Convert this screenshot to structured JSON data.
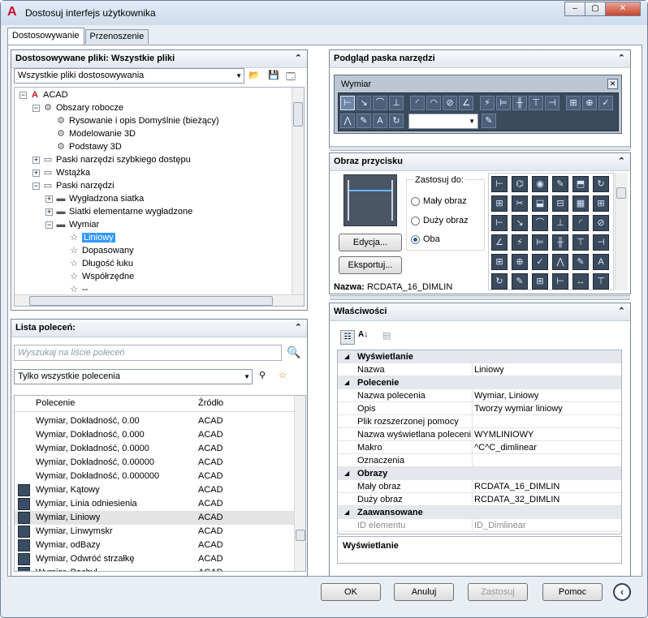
{
  "window": {
    "title": "Dostosuj interfejs użytkownika",
    "minimize": "–",
    "maximize": "▢",
    "close": "✕"
  },
  "tabs": [
    {
      "label": "Dostosowywanie"
    },
    {
      "label": "Przenoszenie"
    }
  ],
  "files_panel": {
    "title": "Dostosowywane pliki: Wszystkie pliki",
    "selector": "Wszystkie pliki dostosowywania"
  },
  "tree": [
    {
      "label": "ACAD",
      "depth": 0,
      "tog": "−",
      "icon": "A"
    },
    {
      "label": "Obszary robocze",
      "depth": 1,
      "tog": "−",
      "icon": "⚙"
    },
    {
      "label": "Rysowanie i opis Domyślnie (bieżący)",
      "depth": 2,
      "tog": "",
      "icon": "⚙"
    },
    {
      "label": "Modelowanie 3D",
      "depth": 2,
      "tog": "",
      "icon": "⚙"
    },
    {
      "label": "Podstawy 3D",
      "depth": 2,
      "tog": "",
      "icon": "⚙"
    },
    {
      "label": "Paski narzędzi szybkiego dostępu",
      "depth": 1,
      "tog": "+",
      "icon": "▭"
    },
    {
      "label": "Wstążka",
      "depth": 1,
      "tog": "+",
      "icon": "▭"
    },
    {
      "label": "Paski narzędzi",
      "depth": 1,
      "tog": "−",
      "icon": "▭"
    },
    {
      "label": "Wygładzona siatka",
      "depth": 2,
      "tog": "+",
      "icon": "▬"
    },
    {
      "label": "Siatki elementarne wygładzone",
      "depth": 2,
      "tog": "+",
      "icon": "▬"
    },
    {
      "label": "Wymiar",
      "depth": 2,
      "tog": "−",
      "icon": "▬"
    },
    {
      "label": "Liniowy",
      "depth": 3,
      "tog": "",
      "icon": "☆",
      "selected": true
    },
    {
      "label": "Dopasowany",
      "depth": 3,
      "tog": "",
      "icon": "☆"
    },
    {
      "label": "Długość łuku",
      "depth": 3,
      "tog": "",
      "icon": "☆"
    },
    {
      "label": "Współrzędne",
      "depth": 3,
      "tog": "",
      "icon": "☆"
    },
    {
      "label": "--",
      "depth": 3,
      "tog": "",
      "icon": "☆"
    }
  ],
  "commands_panel": {
    "title": "Lista poleceń:",
    "search_placeholder": "Wyszukaj na liście poleceń",
    "filter": "Tylko wszystkie polecenia",
    "col_command": "Polecenie",
    "col_source": "Źródło"
  },
  "commands": [
    {
      "name": "Wymiar, Dokładność, 0.00",
      "source": "ACAD",
      "icon": false
    },
    {
      "name": "Wymiar, Dokładność, 0.000",
      "source": "ACAD",
      "icon": false
    },
    {
      "name": "Wymiar, Dokładność, 0.0000",
      "source": "ACAD",
      "icon": false
    },
    {
      "name": "Wymiar, Dokładność, 0.00000",
      "source": "ACAD",
      "icon": false
    },
    {
      "name": "Wymiar, Dokładność, 0.000000",
      "source": "ACAD",
      "icon": false
    },
    {
      "name": "Wymiar, Kątowy",
      "source": "ACAD",
      "icon": true
    },
    {
      "name": "Wymiar, Linia odniesienia",
      "source": "ACAD",
      "icon": true
    },
    {
      "name": "Wymiar, Liniowy",
      "source": "ACAD",
      "icon": true,
      "highlight": true
    },
    {
      "name": "Wymiar, Linwymskr",
      "source": "ACAD",
      "icon": true
    },
    {
      "name": "Wymiar, odBazy",
      "source": "ACAD",
      "icon": true
    },
    {
      "name": "Wymiar, Odwróć strzałkę",
      "source": "ACAD",
      "icon": true
    },
    {
      "name": "Wymiar, Pochyl",
      "source": "ACAD",
      "icon": true
    }
  ],
  "preview_panel": {
    "title": "Podgląd paska narzędzi",
    "toolbar_name": "Wymiar"
  },
  "image_panel": {
    "title": "Obraz przycisku",
    "apply_to": "Zastosuj do:",
    "opt_small": "Mały obraz",
    "opt_large": "Duży obraz",
    "opt_both": "Oba",
    "edit": "Edycja...",
    "export": "Eksportuj...",
    "name_label": "Nazwa:",
    "name_value": "RCDATA_16_DIMLIN"
  },
  "props_panel": {
    "title": "Właściwości",
    "footer": "Wyświetlanie"
  },
  "props": [
    {
      "cat": "Wyświetlanie"
    },
    {
      "k": "Nazwa",
      "v": "Liniowy"
    },
    {
      "cat": "Polecenie"
    },
    {
      "k": "Nazwa polecenia",
      "v": "Wymiar, Liniowy"
    },
    {
      "k": "Opis",
      "v": "Tworzy wymiar liniowy"
    },
    {
      "k": "Plik rozszerzonej pomocy",
      "v": ""
    },
    {
      "k": "Nazwa wyświetlana polecenia",
      "v": "WYMLINIOWY"
    },
    {
      "k": "Makro",
      "v": "^C^C_dimlinear"
    },
    {
      "k": "Oznaczenia",
      "v": ""
    },
    {
      "cat": "Obrazy"
    },
    {
      "k": "Mały obraz",
      "v": "RCDATA_16_DIMLIN"
    },
    {
      "k": "Duży obraz",
      "v": "RCDATA_32_DIMLIN"
    },
    {
      "cat": "Zaawansowane"
    },
    {
      "k": "ID elementu",
      "v": "ID_Dimlinear",
      "dim": true
    }
  ],
  "buttons": {
    "ok": "OK",
    "cancel": "Anuluj",
    "apply": "Zastosuj",
    "help": "Pomoc"
  }
}
